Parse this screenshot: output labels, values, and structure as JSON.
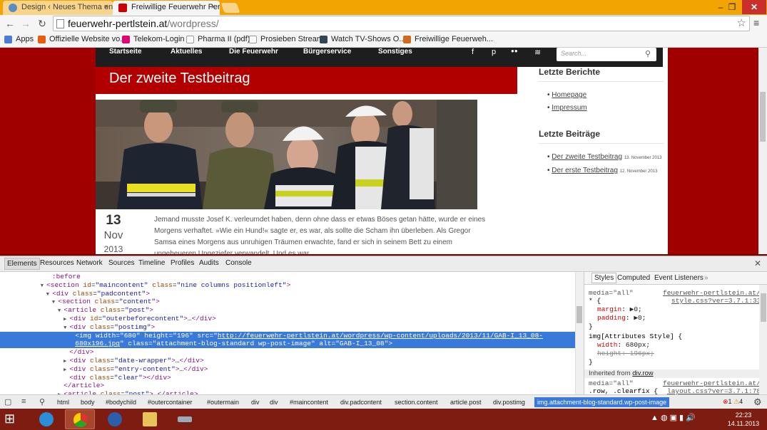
{
  "browser": {
    "tabs": [
      {
        "title": "Design ‹ Neues Thema en…",
        "active": false
      },
      {
        "title": "Freiwillige Feuerwehr Pert…",
        "active": true
      }
    ],
    "close_glyph": "×",
    "window_controls": {
      "minimize": "–",
      "maximize": "❐",
      "close": "✕"
    },
    "address": {
      "host": "feuerwehr-pertlstein.at",
      "path": "/wordpress/"
    },
    "nav_glyphs": {
      "back": "←",
      "forward": "→",
      "reload": "↻",
      "star": "☆",
      "menu": "≡"
    },
    "bookmarks": [
      {
        "label": "Apps",
        "icon": "apps-grid-icon",
        "color": "#4a7dd6"
      },
      {
        "label": "Offizielle Website vo...",
        "icon": "website-icon",
        "color": "#e85c0c"
      },
      {
        "label": "Telekom-Login",
        "icon": "telekom-icon",
        "color": "#e20074"
      },
      {
        "label": "Pharma II (pdf)",
        "icon": "page-icon",
        "color": "#dddddd"
      },
      {
        "label": "Prosieben Stream",
        "icon": "page-icon",
        "color": "#dddddd"
      },
      {
        "label": "Watch TV-Shows O...",
        "icon": "tv-icon",
        "color": "#334455"
      },
      {
        "label": "Freiwillige Feuerweh...",
        "icon": "feuerwehr-icon",
        "color": "#d06a1e"
      }
    ]
  },
  "site": {
    "nav": [
      "Startseite",
      "Aktuelles",
      "Die Feuerwehr",
      "Bürgerservice",
      "Sonstiges"
    ],
    "social": [
      "f",
      "p",
      "●●",
      "≋"
    ],
    "search_placeholder": "Search...",
    "search_glyph": "⚲",
    "post": {
      "title": "Der zweite Testbeitrag",
      "day": "13",
      "month": "Nov",
      "year": "2013",
      "excerpt": "Jemand musste Josef K. verleumdet haben, denn ohne dass er etwas Böses getan hätte, wurde er eines Morgens verhaftet. »Wie ein Hund!« sagte er, es war, als sollte die Scham ihn überleben. Als Gregor Samsa eines Morgens aus unruhigen Träumen erwachte, fand er sich in seinem Bett zu einem ungeheueren Ungeziefer verwandelt. Und es war"
    },
    "sidebar": {
      "reports_title": "Letzte Berichte",
      "reports": [
        "Homepage",
        "Impressum"
      ],
      "posts_title": "Letzte Beiträge",
      "posts": [
        {
          "title": "Der zweite Testbeitrag",
          "date": "13. November 2013"
        },
        {
          "title": "Der erste Testbeitrag",
          "date": "12. November 2013"
        }
      ]
    }
  },
  "devtools": {
    "tabs": [
      "Elements",
      "Resources",
      "Network",
      "Sources",
      "Timeline",
      "Profiles",
      "Audits",
      "Console"
    ],
    "dom_lines": [
      {
        "indent": 9,
        "tw": "",
        "parts": [
          [
            "tg",
            ":before"
          ]
        ]
      },
      {
        "indent": 8,
        "tw": "▼",
        "parts": [
          [
            "tg",
            "<section "
          ],
          [
            "at",
            "id"
          ],
          [
            "tx",
            "="
          ],
          [
            "av",
            "\"maincontent\""
          ],
          [
            "tx",
            " "
          ],
          [
            "at",
            "class"
          ],
          [
            "tx",
            "="
          ],
          [
            "av",
            "\"nine columns positionleft\""
          ],
          [
            "tg",
            ">"
          ]
        ]
      },
      {
        "indent": 9,
        "tw": "▼",
        "parts": [
          [
            "tg",
            "<div "
          ],
          [
            "at",
            "class"
          ],
          [
            "tx",
            "="
          ],
          [
            "av",
            "\"padcontent\""
          ],
          [
            "tg",
            ">"
          ]
        ]
      },
      {
        "indent": 10,
        "tw": "▼",
        "parts": [
          [
            "tg",
            "<section "
          ],
          [
            "at",
            "class"
          ],
          [
            "tx",
            "="
          ],
          [
            "av",
            "\"content\""
          ],
          [
            "tg",
            ">"
          ]
        ]
      },
      {
        "indent": 11,
        "tw": "▼",
        "parts": [
          [
            "tg",
            "<article "
          ],
          [
            "at",
            "class"
          ],
          [
            "tx",
            "="
          ],
          [
            "av",
            "\"post\""
          ],
          [
            "tg",
            ">"
          ]
        ]
      },
      {
        "indent": 12,
        "tw": "▶",
        "parts": [
          [
            "tg",
            "<div "
          ],
          [
            "at",
            "id"
          ],
          [
            "tx",
            "="
          ],
          [
            "av",
            "\"outerbeforecontent\""
          ],
          [
            "tg",
            ">"
          ],
          [
            "tx",
            "…"
          ],
          [
            "tg",
            "</div>"
          ]
        ]
      },
      {
        "indent": 12,
        "tw": "▼",
        "parts": [
          [
            "tg",
            "<div "
          ],
          [
            "at",
            "class"
          ],
          [
            "tx",
            "="
          ],
          [
            "av",
            "\"postimg\""
          ],
          [
            "tg",
            ">"
          ]
        ]
      },
      {
        "indent": 13,
        "tw": "",
        "sel": true,
        "parts": [
          [
            "tg",
            "<img "
          ],
          [
            "at",
            "width"
          ],
          [
            "tx",
            "="
          ],
          [
            "av",
            "\"680\""
          ],
          [
            "tx",
            " "
          ],
          [
            "at",
            "height"
          ],
          [
            "tx",
            "="
          ],
          [
            "av",
            "\"196\""
          ],
          [
            "tx",
            " "
          ],
          [
            "at",
            "src"
          ],
          [
            "tx",
            "="
          ],
          [
            "tx",
            "\""
          ],
          [
            "lk",
            "http://feuerwehr-pertlstein.at/wordpress/wp-content/uploads/2013/11/GAB-I_13_08-"
          ]
        ]
      },
      {
        "indent": 13,
        "tw": "",
        "sel": true,
        "parts": [
          [
            "lk",
            "680x196.jpg"
          ],
          [
            "tx",
            "\" "
          ],
          [
            "at",
            "class"
          ],
          [
            "tx",
            "="
          ],
          [
            "av",
            "\"attachment-blog-standard wp-post-image\""
          ],
          [
            "tx",
            " "
          ],
          [
            "at",
            "alt"
          ],
          [
            "tx",
            "="
          ],
          [
            "av",
            "\"GAB-I_13_08\""
          ],
          [
            "tg",
            ">"
          ]
        ]
      },
      {
        "indent": 12,
        "tw": "",
        "parts": [
          [
            "tg",
            "</div>"
          ]
        ]
      },
      {
        "indent": 12,
        "tw": "▶",
        "parts": [
          [
            "tg",
            "<div "
          ],
          [
            "at",
            "class"
          ],
          [
            "tx",
            "="
          ],
          [
            "av",
            "\"date-wrapper\""
          ],
          [
            "tg",
            ">"
          ],
          [
            "tx",
            "…"
          ],
          [
            "tg",
            "</div>"
          ]
        ]
      },
      {
        "indent": 12,
        "tw": "▶",
        "parts": [
          [
            "tg",
            "<div "
          ],
          [
            "at",
            "class"
          ],
          [
            "tx",
            "="
          ],
          [
            "av",
            "\"entry-content\""
          ],
          [
            "tg",
            ">"
          ],
          [
            "tx",
            "…"
          ],
          [
            "tg",
            "</div>"
          ]
        ]
      },
      {
        "indent": 12,
        "tw": "",
        "parts": [
          [
            "tg",
            "<div "
          ],
          [
            "at",
            "class"
          ],
          [
            "tx",
            "="
          ],
          [
            "av",
            "\"clear\""
          ],
          [
            "tg",
            "></div>"
          ]
        ]
      },
      {
        "indent": 11,
        "tw": "",
        "parts": [
          [
            "tg",
            "</article>"
          ]
        ]
      },
      {
        "indent": 11,
        "tw": "▶",
        "parts": [
          [
            "tg",
            "<article "
          ],
          [
            "at",
            "class"
          ],
          [
            "tx",
            "="
          ],
          [
            "av",
            "\"post\""
          ],
          [
            "tg",
            ">"
          ],
          [
            "tx",
            "…"
          ],
          [
            "tg",
            "</article>"
          ]
        ]
      }
    ],
    "styles": {
      "tabs": [
        "Styles",
        "Computed",
        "Event Listeners",
        "»"
      ],
      "rule1": {
        "media": "media=\"all\"",
        "src": "feuerwehr-pertlstein.at/",
        "src2": "style.css?ver=3.7.1:33",
        "selector": "* {",
        "p1n": "margin",
        "p1v": "▶0;",
        "p2n": "padding",
        "p2v": "▶0;",
        "close": "}"
      },
      "rule2": {
        "selector": "img[Attributes Style] {",
        "p1n": "width",
        "p1v": "680px;",
        "p2n": "height",
        "p2v": "196px;",
        "close": "}"
      },
      "inherited_label": "Inherited from",
      "inherited_target": "div.row",
      "rule3": {
        "media": "media=\"all\"",
        "src": "feuerwehr-pertlstein.at/",
        "src2": "layout.css?ver=3.7.1:78",
        "selector": ".row, .clearfix {"
      }
    },
    "breadcrumbs": [
      "html",
      "body",
      "#bodychild",
      "#outercontainer",
      "#outermain",
      "div",
      "div",
      "#maincontent",
      "div.padcontent",
      "section.content",
      "article.post",
      "div.postimg",
      "img.attachment-blog-standard.wp-post-image"
    ],
    "errors": "1",
    "warnings": "4",
    "close_glyph": "✕",
    "icon_glyphs": {
      "dock": "▢",
      "console": "≡",
      "search": "⚲",
      "gear": "⚙"
    }
  },
  "taskbar": {
    "start_glyph": "⊞",
    "tray_glyphs": "▲ ◍ ▣ ▮ 🔊",
    "time": "22:23",
    "date": "14.11.2013"
  }
}
